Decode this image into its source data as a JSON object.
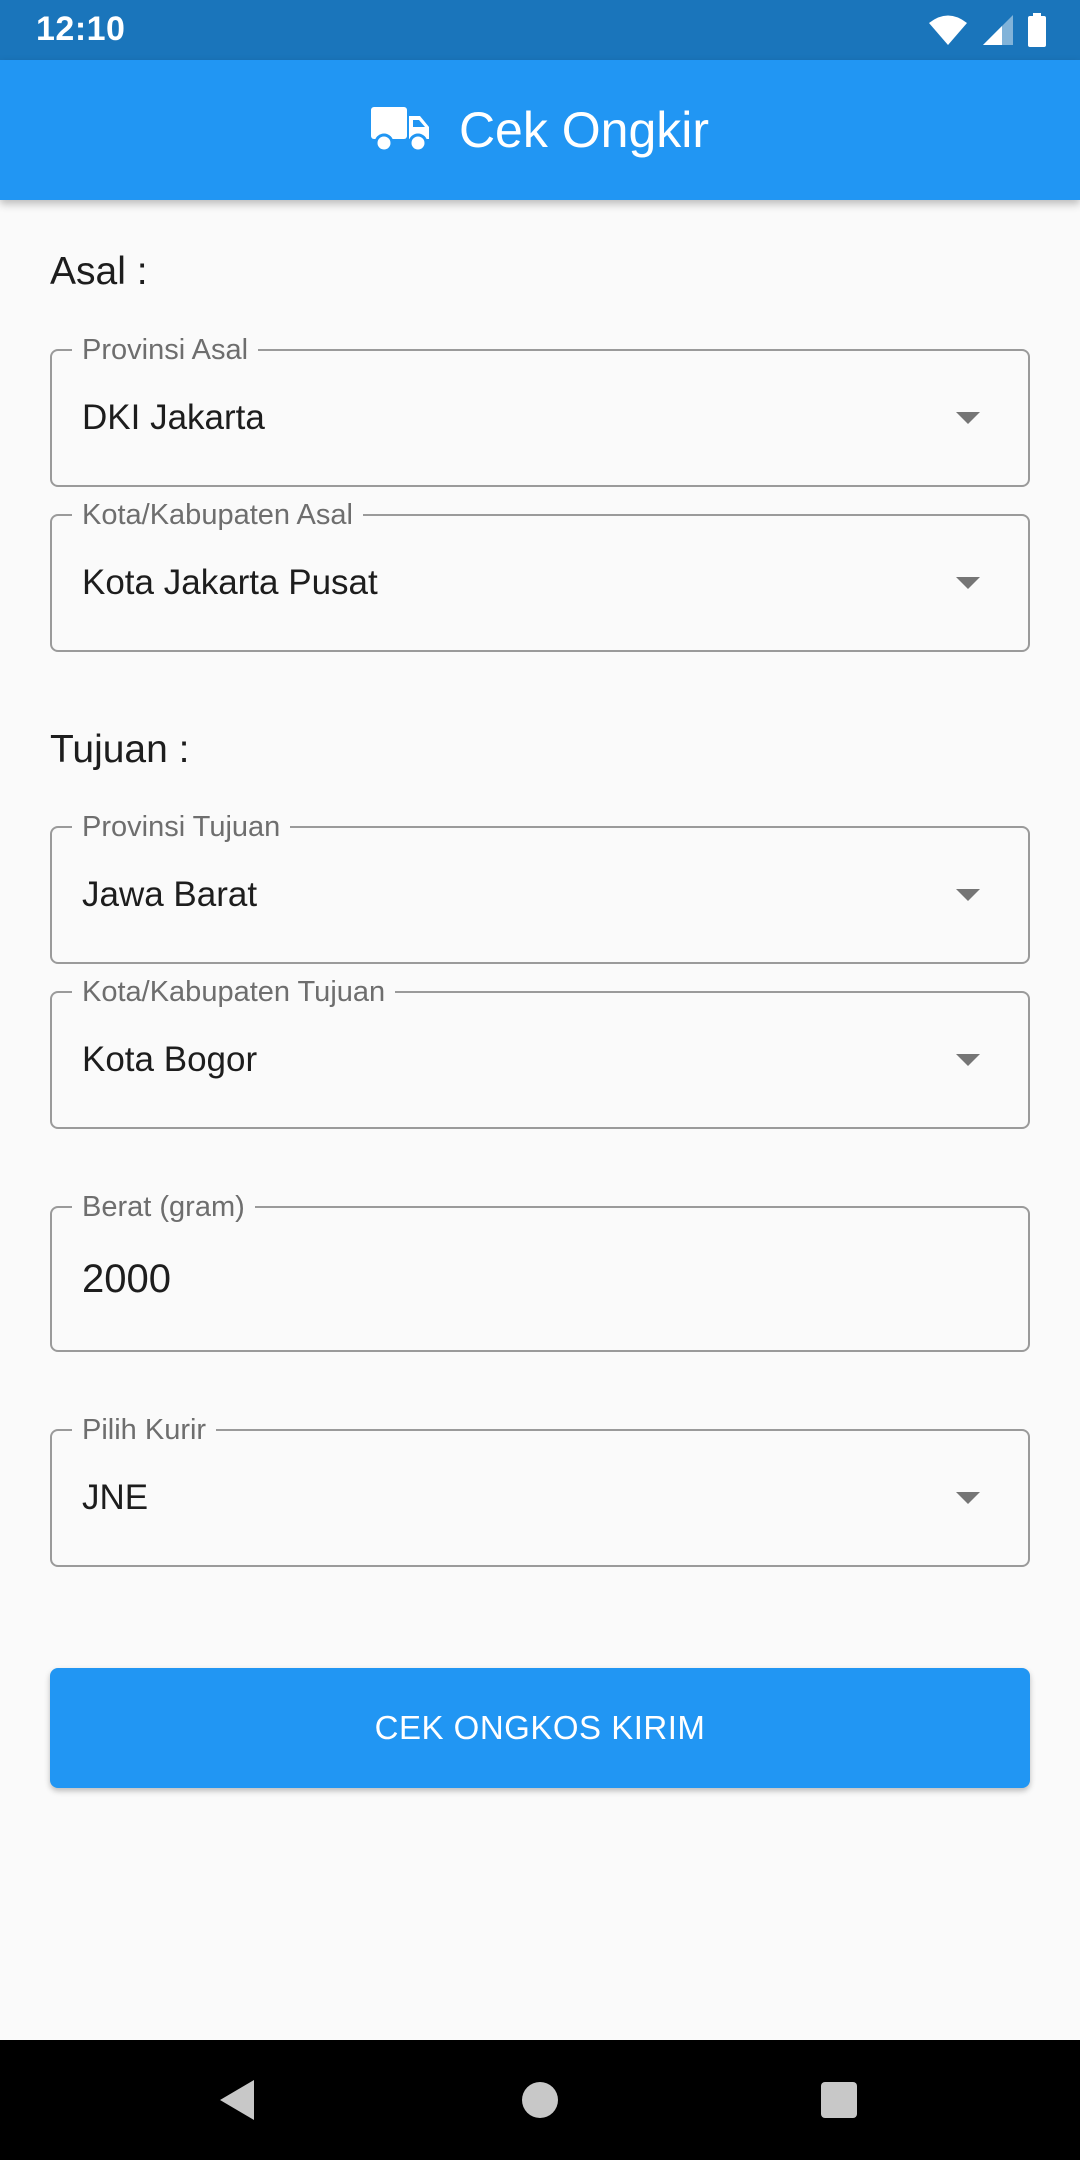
{
  "status_bar": {
    "time": "12:10"
  },
  "app_bar": {
    "title": "Cek Ongkir",
    "icon": "truck-icon"
  },
  "origin": {
    "section_label": "Asal :",
    "province": {
      "label": "Provinsi Asal",
      "value": "DKI Jakarta"
    },
    "city": {
      "label": "Kota/Kabupaten Asal",
      "value": "Kota Jakarta Pusat"
    }
  },
  "destination": {
    "section_label": "Tujuan :",
    "province": {
      "label": "Provinsi Tujuan",
      "value": "Jawa Barat"
    },
    "city": {
      "label": "Kota/Kabupaten Tujuan",
      "value": "Kota Bogor"
    }
  },
  "weight": {
    "label": "Berat (gram)",
    "value": "2000"
  },
  "courier": {
    "label": "Pilih Kurir",
    "value": "JNE"
  },
  "submit": {
    "label": "CEK ONGKOS KIRIM"
  },
  "colors": {
    "primary": "#2196f3",
    "status_bar": "#1a75bb",
    "background": "#fafafa"
  }
}
